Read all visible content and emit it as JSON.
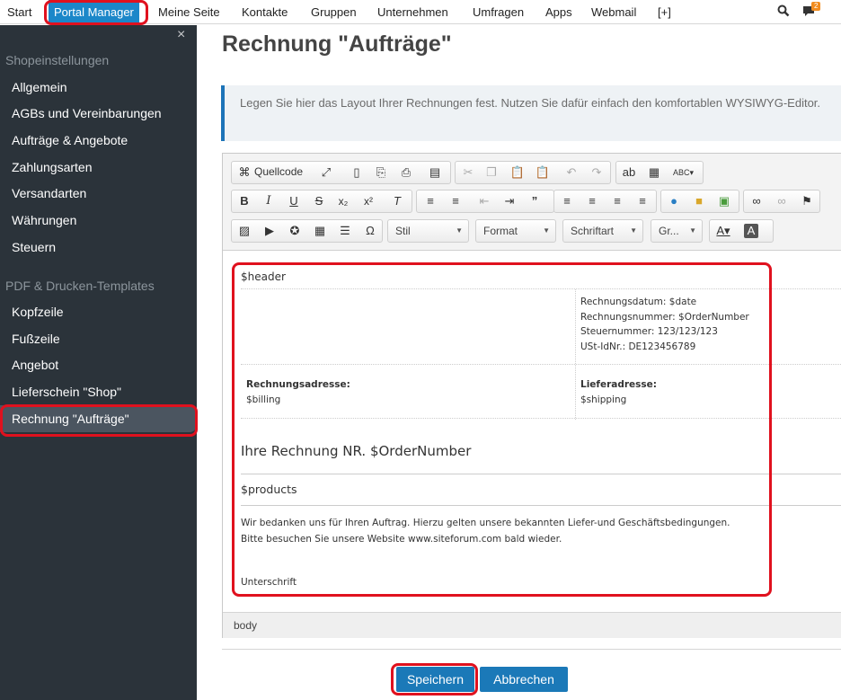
{
  "topnav": {
    "items": [
      "Start",
      "Portal Manager",
      "Meine Seite",
      "Kontakte",
      "Gruppen",
      "Unternehmen",
      "Umfragen",
      "Apps",
      "Webmail",
      "[+]"
    ],
    "notification_count": "2"
  },
  "sidebar": {
    "close": "×",
    "section1": "Shopeinstellungen",
    "items1": [
      "Allgemein",
      "AGBs und Vereinbarungen",
      "Aufträge & Angebote",
      "Zahlungsarten",
      "Versandarten",
      "Währungen",
      "Steuern"
    ],
    "section2": "PDF & Drucken-Templates",
    "items2": [
      "Kopfzeile",
      "Fußzeile",
      "Angebot",
      "Lieferschein \"Shop\"",
      "Rechnung \"Aufträge\""
    ]
  },
  "page": {
    "title": "Rechnung \"Aufträge\"",
    "info": "Legen Sie hier das Layout Ihrer Rechnungen fest. Nutzen Sie dafür einfach den komfortablen WYSIWYG-Editor."
  },
  "toolbar": {
    "source_label": "Quellcode",
    "style_label": "Stil",
    "format_label": "Format",
    "font_label": "Schriftart",
    "size_label": "Gr..."
  },
  "document": {
    "header": "$header",
    "meta_lines": [
      "Rechnungsdatum: $date",
      "Rechnungsnummer: $OrderNumber",
      "Steuernummer: 123/123/123",
      "USt-IdNr.: DE123456789"
    ],
    "billing_label": "Rechnungsadresse:",
    "billing_value": "$billing",
    "shipping_label": "Lieferadresse:",
    "shipping_value": "$shipping",
    "invoice_heading": "Ihre Rechnung NR. $OrderNumber",
    "products": "$products",
    "thanks_line1": "Wir bedanken uns für Ihren Auftrag. Hierzu gelten unsere bekannten Liefer-und Geschäftsbedingungen.",
    "thanks_line2": "Bitte besuchen Sie unsere Website www.siteforum.com bald wieder.",
    "signature": "Unterschrift"
  },
  "statusbar": {
    "path": "body"
  },
  "actions": {
    "save": "Speichern",
    "cancel": "Abbrechen"
  },
  "colors": {
    "accent": "#1b87c9",
    "sidebar_bg": "#2b333a",
    "highlight": "#e0111e"
  }
}
